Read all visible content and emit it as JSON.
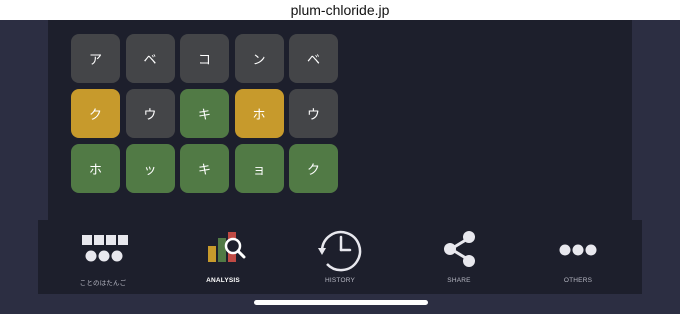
{
  "url": "plum-chloride.jp",
  "board": {
    "rows": [
      [
        {
          "ch": "ア",
          "state": "gray"
        },
        {
          "ch": "ベ",
          "state": "gray"
        },
        {
          "ch": "コ",
          "state": "gray"
        },
        {
          "ch": "ン",
          "state": "gray"
        },
        {
          "ch": "ベ",
          "state": "gray"
        }
      ],
      [
        {
          "ch": "ク",
          "state": "yellow"
        },
        {
          "ch": "ウ",
          "state": "gray"
        },
        {
          "ch": "キ",
          "state": "green"
        },
        {
          "ch": "ホ",
          "state": "yellow"
        },
        {
          "ch": "ウ",
          "state": "gray"
        }
      ],
      [
        {
          "ch": "ホ",
          "state": "green"
        },
        {
          "ch": "ッ",
          "state": "green"
        },
        {
          "ch": "キ",
          "state": "green"
        },
        {
          "ch": "ョ",
          "state": "green"
        },
        {
          "ch": "ク",
          "state": "green"
        }
      ]
    ]
  },
  "nav": {
    "items": [
      {
        "label": "ことのはたんご",
        "icon": "squares-dots-icon"
      },
      {
        "label": "ANALYSIS",
        "icon": "analysis-icon",
        "active": true
      },
      {
        "label": "HISTORY",
        "icon": "clock-icon"
      },
      {
        "label": "SHARE",
        "icon": "share-icon"
      },
      {
        "label": "OTHERS",
        "icon": "more-dots-icon"
      }
    ]
  },
  "colors": {
    "gray": "#444548",
    "yellow": "#c79a2c",
    "green": "#517a45",
    "background": "#1d1f2c"
  }
}
